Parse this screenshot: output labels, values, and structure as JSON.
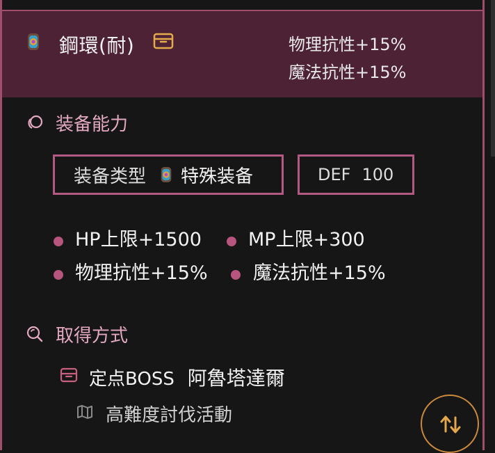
{
  "item": {
    "name": "鋼環(耐)",
    "stat_1": "物理抗性+15%",
    "stat_2": "魔法抗性+15%"
  },
  "ability_section": {
    "title": "装备能力",
    "type_label": "装备类型",
    "type_value": "特殊装备",
    "def_label": "DEF",
    "def_value": "100",
    "stats": [
      "HP上限+1500",
      "MP上限+300",
      "物理抗性+15%",
      "魔法抗性+15%"
    ]
  },
  "acquire_section": {
    "title": "取得方式",
    "source_type": "定点BOSS",
    "source_name": "阿魯塔達爾",
    "sub_source": "高難度討伐活動"
  },
  "colors": {
    "accent": "#b45a82",
    "header_bg": "#4e2235",
    "fab_border": "#c9893d"
  },
  "icons": {
    "item": "ring-gem-icon",
    "inventory": "box-icon",
    "ability": "ring-icon",
    "acquire": "search-icon",
    "source": "box-icon",
    "location": "map-icon",
    "fab": "sort-arrows-icon"
  }
}
